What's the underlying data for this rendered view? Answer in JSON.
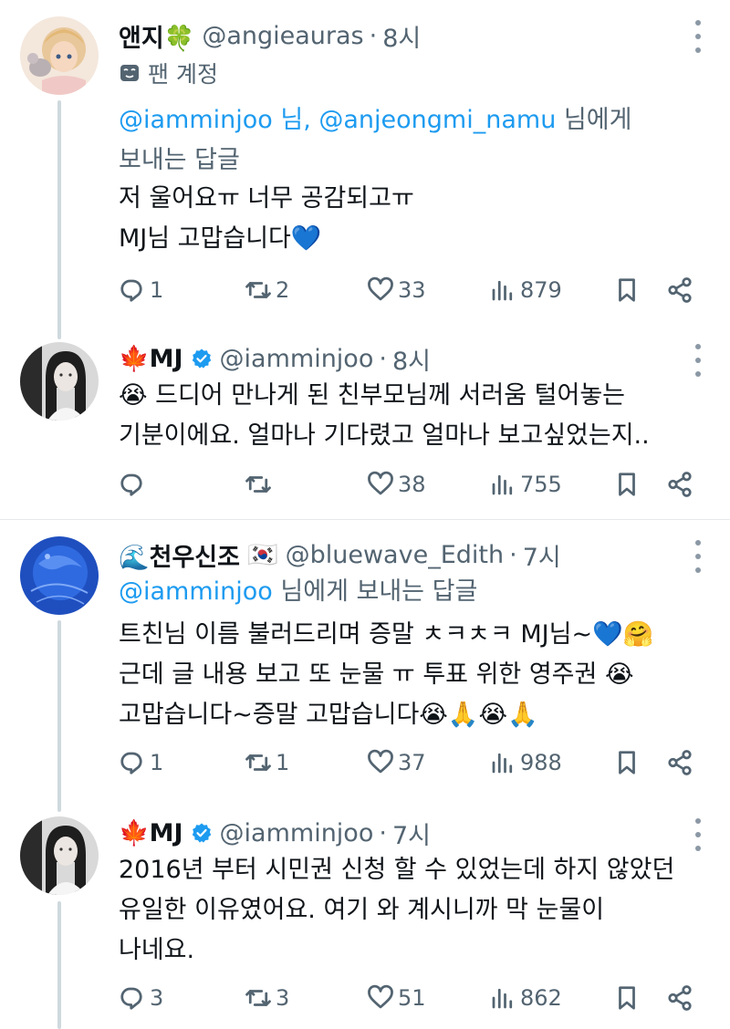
{
  "posts": [
    {
      "name": "앤지🍀",
      "handle": "@angieauras",
      "time": "8시",
      "fan_label": "팬 계정",
      "reply_to_mentions": "@iamminjoo 님, @anjeongmi_namu",
      "reply_to_suffix": " 님에게",
      "reply_line2": "보내는 답글",
      "text_lines": [
        "저 울어요ㅠ 너무 공감되고ㅠ",
        "MJ님 고맙습니다💙"
      ],
      "stats": {
        "replies": "1",
        "reposts": "2",
        "likes": "33",
        "views": "879"
      }
    },
    {
      "name": "🍁MJ",
      "handle": "@iamminjoo",
      "time": "8시",
      "verified": true,
      "text_lines": [
        "😭 드디어 만나게 된 친부모님께 서러움 털어놓는",
        "기분이에요. 얼마나 기다렸고 얼마나 보고싶었는지.."
      ],
      "stats": {
        "replies": "",
        "reposts": "",
        "likes": "38",
        "views": "755"
      }
    },
    {
      "name": "🌊천우신조",
      "flag": "🇰🇷",
      "handle": "@bluewave_Edith",
      "time": "7시",
      "reply_to_mentions": "@iamminjoo",
      "reply_to_suffix": " 님에게 보내는 답글",
      "text_lines": [
        "트친님 이름 불러드리며 증말 ㅊㅋㅊㅋ MJ님~💙🤗",
        "근데 글 내용 보고 또 눈물 ㅠ 투표 위한 영주권 😭",
        "고맙습니다~증말 고맙습니다😭🙏😭🙏"
      ],
      "stats": {
        "replies": "1",
        "reposts": "1",
        "likes": "37",
        "views": "988"
      }
    },
    {
      "name": "🍁MJ",
      "handle": "@iamminjoo",
      "time": "7시",
      "verified": true,
      "text_lines": [
        "2016년 부터 시민권 신청 할 수 있었는데 하지 않았던",
        "유일한 이유였어요. 여기 와 계시니까 막 눈물이",
        "나네요."
      ],
      "stats": {
        "replies": "3",
        "reposts": "3",
        "likes": "51",
        "views": "862"
      }
    }
  ],
  "colors": {
    "accent": "#1d9bf0",
    "secondary": "#536471",
    "text": "#0f1419",
    "verified": "#1d9bf0"
  },
  "icons": [
    "more-icon",
    "reply-icon",
    "repost-icon",
    "like-icon",
    "views-icon",
    "bookmark-icon",
    "share-icon",
    "verified-icon",
    "mask-icon"
  ]
}
